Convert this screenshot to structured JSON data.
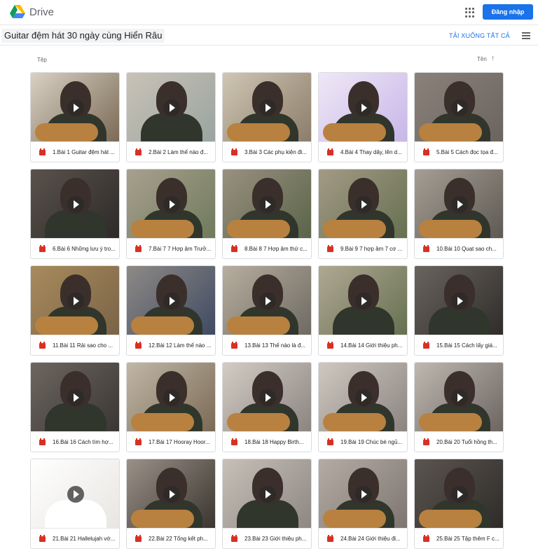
{
  "header": {
    "brand": "Drive",
    "signin_label": "Đăng nhập"
  },
  "folder": {
    "title": "Guitar đệm hát 30 ngày cùng Hiển Râu",
    "download_all": "TẢI XUỐNG TẤT CẢ"
  },
  "columns": {
    "files": "Tệp",
    "sort_label": "Tên",
    "sort_arrow": "↑"
  },
  "icons": {
    "video": "video-file-icon",
    "play": "play-icon",
    "apps": "apps-grid-icon",
    "list": "list-view-icon"
  },
  "colors": {
    "accent": "#1a73e8",
    "video_icon": "#d93025"
  },
  "files": [
    {
      "name": "1.Bài 1 Guitar đệm hát ..."
    },
    {
      "name": "2.Bài 2 Làm thế nào đ..."
    },
    {
      "name": "3.Bài 3 Các phụ kiện đi..."
    },
    {
      "name": "4.Bài 4 Thay dây, lên d..."
    },
    {
      "name": "5.Bài 5 Cách đọc tọa đ..."
    },
    {
      "name": "6.Bài 6 Những lưu ý tro..."
    },
    {
      "name": "7.Bài 7 7 Hợp âm Trưở..."
    },
    {
      "name": "8.Bài 8 7 Hợp âm thứ c..."
    },
    {
      "name": "9.Bài 9 7 hợp âm 7 cơ ..."
    },
    {
      "name": "10.Bài 10 Quạt sao ch..."
    },
    {
      "name": "11.Bài 11 Rải sao cho ..."
    },
    {
      "name": "12.Bài 12 Làm thế nào ..."
    },
    {
      "name": "13.Bài 13 Thế nào là đ..."
    },
    {
      "name": "14.Bài 14 Giới thiệu ph..."
    },
    {
      "name": "15.Bài 15 Cách lấy giá..."
    },
    {
      "name": "16.Bài 16 Cách tìm hợ..."
    },
    {
      "name": "17.Bài 17 Hooray Hoor..."
    },
    {
      "name": "18.Bài 18 Happy Birth..."
    },
    {
      "name": "19.Bài 19 Chúc bé ngủ..."
    },
    {
      "name": "20.Bài 20 Tuổi hồng th..."
    },
    {
      "name": "21.Bài 21 Hallelujah vớ..."
    },
    {
      "name": "22.Bài 22 Tổng kết ph..."
    },
    {
      "name": "23.Bài 23 Giới thiệu ph..."
    },
    {
      "name": "24.Bài 24 Giới thiệu đi..."
    },
    {
      "name": "25.Bài 25 Tập thêm F c..."
    }
  ]
}
